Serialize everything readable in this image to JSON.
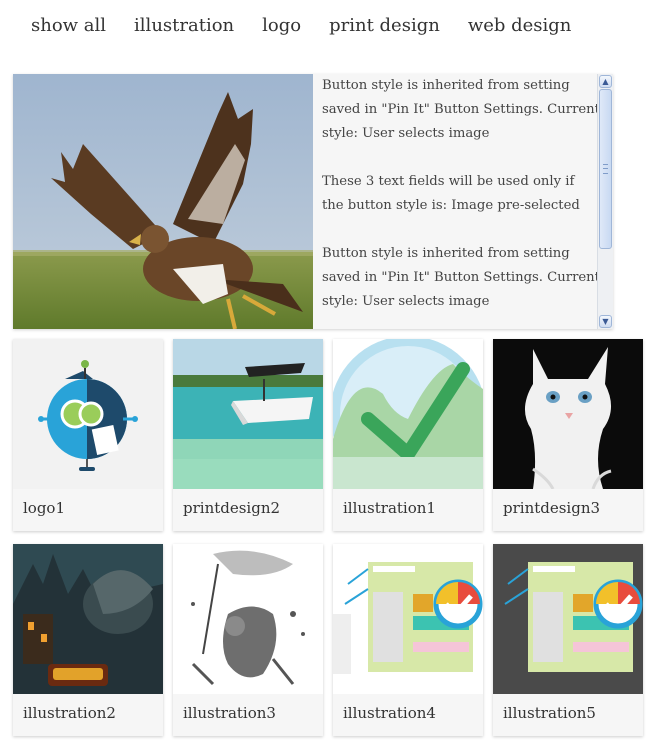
{
  "filters": [
    {
      "label": "show all"
    },
    {
      "label": "illustration"
    },
    {
      "label": "logo"
    },
    {
      "label": "print design"
    },
    {
      "label": "web design"
    }
  ],
  "featured": {
    "paragraphs": [
      "Button style is inherited from setting saved in \"Pin It\" Button Settings. Current style: User selects image",
      "These 3 text fields will be used only if the button style is: Image pre-selected",
      "Button style is inherited from setting saved in \"Pin It\" Button Settings. Current style: User selects image"
    ]
  },
  "items": [
    {
      "label": "logo1"
    },
    {
      "label": "printdesign2"
    },
    {
      "label": "illustration1"
    },
    {
      "label": "printdesign3"
    },
    {
      "label": "illustration2"
    },
    {
      "label": "illustration3"
    },
    {
      "label": "illustration4"
    },
    {
      "label": "illustration5"
    }
  ],
  "icons": {
    "scroll_up": "▲",
    "scroll_down": "▼"
  }
}
